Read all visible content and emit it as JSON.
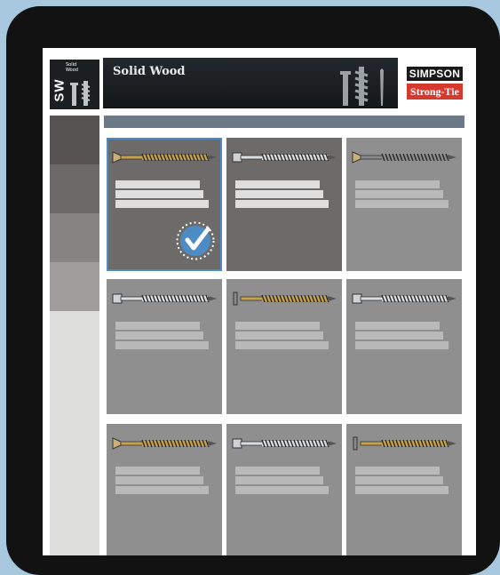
{
  "header": {
    "logo_text": "SW",
    "logo_subtitle_line1": "Solid",
    "logo_subtitle_line2": "Wood",
    "banner_title": "Solid Wood",
    "brand_line1": "SIMPSON",
    "brand_line2": "Strong-Tie"
  },
  "colors": {
    "sidebar": [
      "#575353",
      "#6c6a69",
      "#858483",
      "#9f9e9d"
    ],
    "accent": "#4d8bc4",
    "brand_red": "#d63a2f"
  },
  "products": [
    {
      "id": 1,
      "selected": true,
      "head": "flat",
      "shank": "gold"
    },
    {
      "id": 2,
      "selected": false,
      "head": "hex",
      "shank": "silver"
    },
    {
      "id": 3,
      "selected": false,
      "head": "flat",
      "shank": "grey"
    },
    {
      "id": 4,
      "selected": false,
      "head": "hex",
      "shank": "silver"
    },
    {
      "id": 5,
      "selected": false,
      "head": "washer",
      "shank": "gold"
    },
    {
      "id": 6,
      "selected": false,
      "head": "hex",
      "shank": "silver"
    },
    {
      "id": 7,
      "selected": false,
      "head": "flat",
      "shank": "gold"
    },
    {
      "id": 8,
      "selected": false,
      "head": "hex",
      "shank": "silver"
    },
    {
      "id": 9,
      "selected": false,
      "head": "washer",
      "shank": "gold"
    }
  ]
}
